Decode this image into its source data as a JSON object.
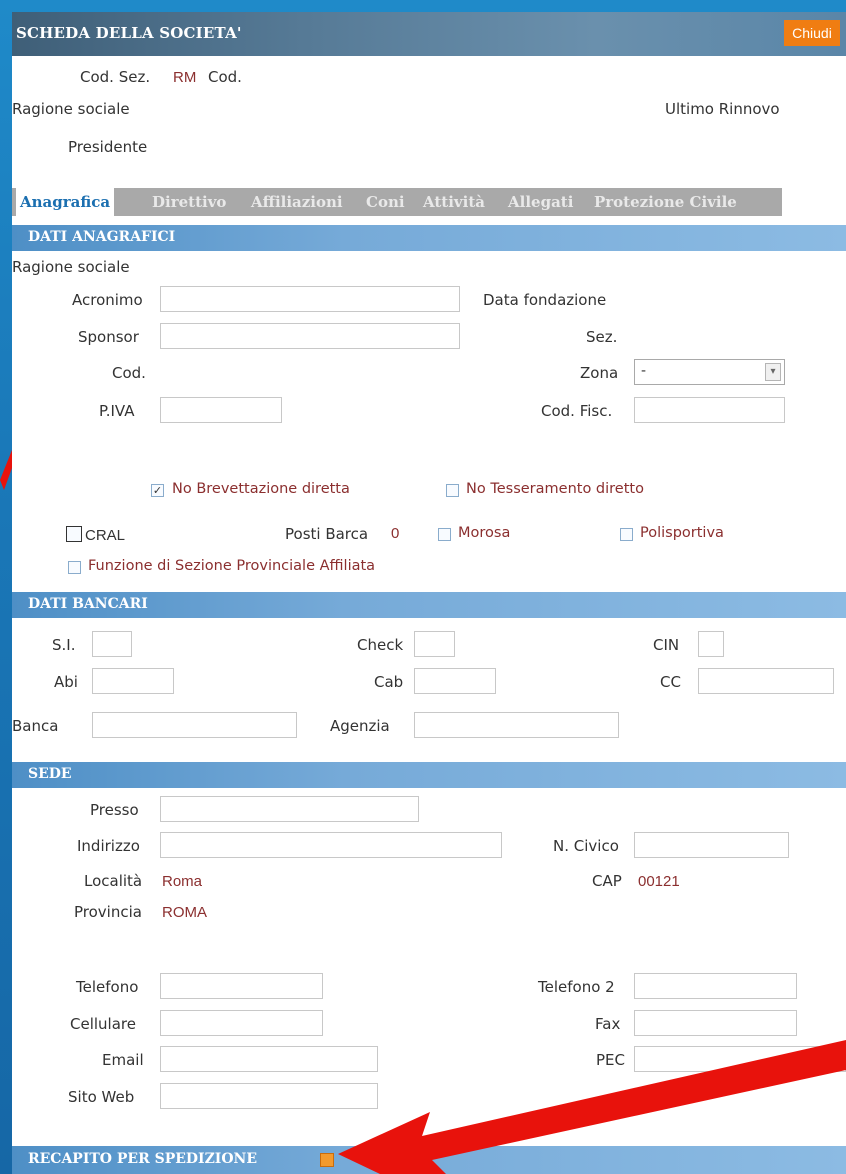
{
  "window": {
    "title": "SCHEDA DELLA SOCIETA'",
    "close_label": "Chiudi"
  },
  "header": {
    "cod_sez_label": "Cod. Sez.",
    "cod_sez_value": "RM",
    "cod_label": "Cod.",
    "ragione_sociale_label": "Ragione sociale",
    "ultimo_rinnovo_label": "Ultimo Rinnovo",
    "presidente_label": "Presidente"
  },
  "tabs": [
    {
      "label": "Anagrafica",
      "active": true
    },
    {
      "label": "Direttivo"
    },
    {
      "label": "Affiliazioni"
    },
    {
      "label": "Coni"
    },
    {
      "label": "Attività"
    },
    {
      "label": "Allegati"
    },
    {
      "label": "Protezione Civile"
    }
  ],
  "dati_anagrafici": {
    "title": "DATI ANAGRAFICI",
    "ragione_sociale_label": "Ragione sociale",
    "acronimo_label": "Acronimo",
    "data_fondazione_label": "Data fondazione",
    "sponsor_label": "Sponsor",
    "sez_label": "Sez.",
    "cod_label": "Cod.",
    "zona_label": "Zona",
    "zona_value": "-",
    "piva_label": "P.IVA",
    "cod_fisc_label": "Cod. Fisc.",
    "no_brevettazione_label": "No Brevettazione diretta",
    "no_brevettazione_checked": true,
    "no_tesseramento_label": "No Tesseramento diretto",
    "cral_label": "CRAL",
    "posti_barca_label": "Posti Barca",
    "posti_barca_value": "0",
    "morosa_label": "Morosa",
    "polisportiva_label": "Polisportiva",
    "funzione_label": "Funzione di Sezione Provinciale Affiliata"
  },
  "dati_bancari": {
    "title": "DATI BANCARI",
    "si_label": "S.I.",
    "check_label": "Check",
    "cin_label": "CIN",
    "abi_label": "Abi",
    "cab_label": "Cab",
    "cc_label": "CC",
    "banca_label": "Banca",
    "agenzia_label": "Agenzia"
  },
  "sede": {
    "title": "SEDE",
    "presso_label": "Presso",
    "indirizzo_label": "Indirizzo",
    "n_civico_label": "N. Civico",
    "localita_label": "Località",
    "localita_value": "Roma",
    "cap_label": "CAP",
    "cap_value": "00121",
    "provincia_label": "Provincia",
    "provincia_value": "ROMA",
    "telefono_label": "Telefono",
    "telefono2_label": "Telefono 2",
    "cellulare_label": "Cellulare",
    "fax_label": "Fax",
    "email_label": "Email",
    "pec_label": "PEC",
    "sito_web_label": "Sito Web"
  },
  "recapito": {
    "title": "RECAPITO PER SPEDIZIONE",
    "expand_icon": "plus-box-icon"
  },
  "colors": {
    "accent": "#f07d12",
    "section": "#76aad8",
    "value": "#8b2f2f",
    "annotation_arrow": "#e8120c"
  }
}
